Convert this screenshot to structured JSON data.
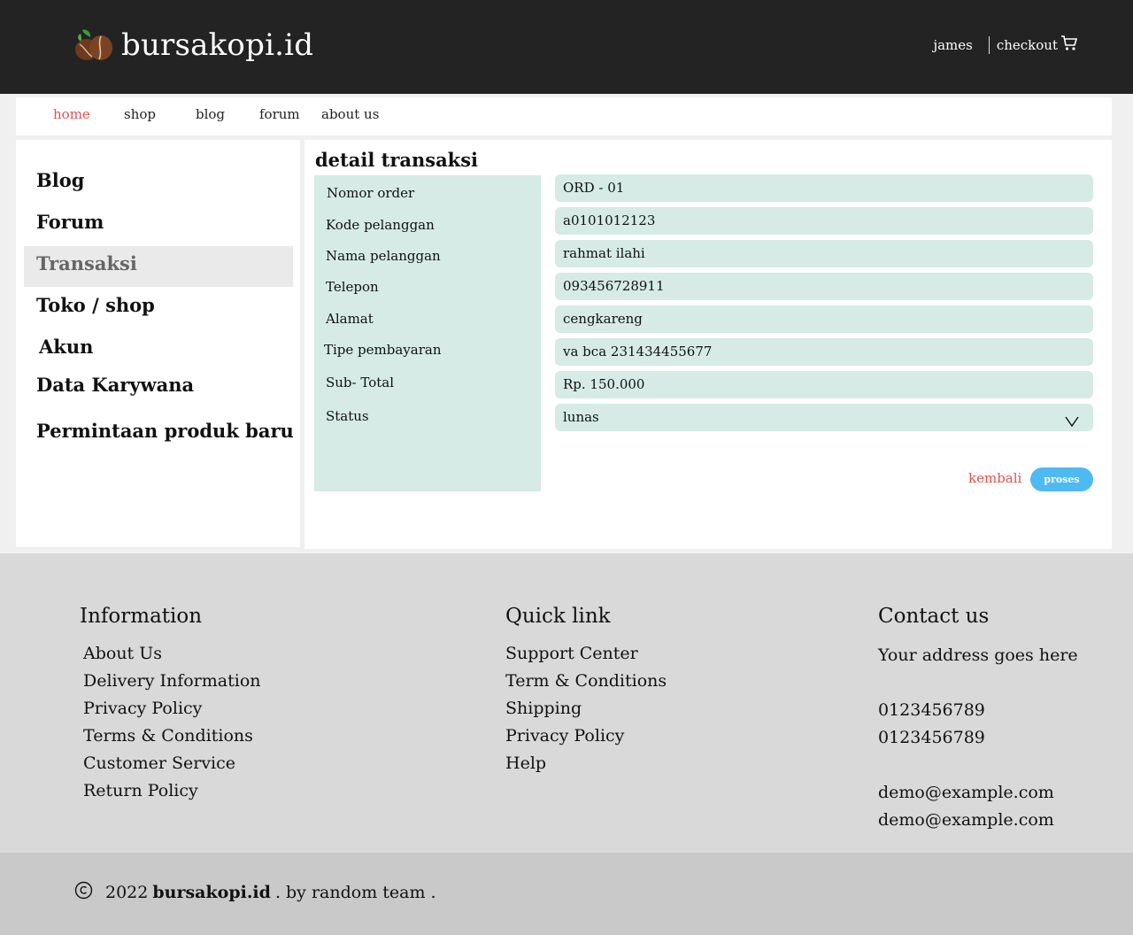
{
  "header": {
    "brand": "bursakopi.id",
    "user": "james",
    "checkout": "checkout"
  },
  "nav": {
    "items": [
      "home",
      "shop",
      "blog",
      "forum",
      "about us"
    ],
    "active": "home"
  },
  "sidebar": {
    "items": [
      "Blog",
      "Forum",
      "Transaksi",
      "Toko / shop",
      "Akun",
      "Data Karywana",
      "Permintaan produk baru"
    ],
    "active": "Transaksi"
  },
  "main": {
    "title": "detail transaksi",
    "fields": [
      {
        "label": "Nomor order",
        "value": "ORD - 01"
      },
      {
        "label": "Kode pelanggan",
        "value": "a0101012123"
      },
      {
        "label": "Nama pelanggan",
        "value": "rahmat ilahi"
      },
      {
        "label": "Telepon",
        "value": "093456728911"
      },
      {
        "label": "Alamat",
        "value": "cengkareng"
      },
      {
        "label": "Tipe pembayaran",
        "value": "va bca 231434455677"
      },
      {
        "label": "Sub- Total",
        "value": "Rp. 150.000"
      },
      {
        "label": "Status",
        "value": "lunas"
      }
    ],
    "back_label": "kembali",
    "submit_label": "proses"
  },
  "footer": {
    "information": {
      "title": "Information",
      "links": [
        "About Us",
        "Delivery Information",
        "Privacy Policy",
        "Terms & Conditions",
        "Customer Service",
        "Return Policy"
      ]
    },
    "quicklink": {
      "title": "Quick link",
      "links": [
        "Support Center",
        "Term & Conditions",
        "Shipping",
        "Privacy Policy",
        "Help"
      ]
    },
    "contact": {
      "title": "Contact us",
      "address": "Your address goes here",
      "phones": [
        "0123456789",
        "0123456789"
      ],
      "emails": [
        "demo@example.com",
        "demo@example.com"
      ]
    }
  },
  "copyright": {
    "year": "2022",
    "brand": "bursakopi.id",
    "suffix": ". by random team ."
  },
  "colors": {
    "topbar": "#232323",
    "accent_red": "#e0524f",
    "field_bg": "#d6ebe5",
    "button_blue": "#4fb9f2",
    "footer_bg": "#d9d9d9",
    "bottombar_bg": "#c9c9c9"
  }
}
